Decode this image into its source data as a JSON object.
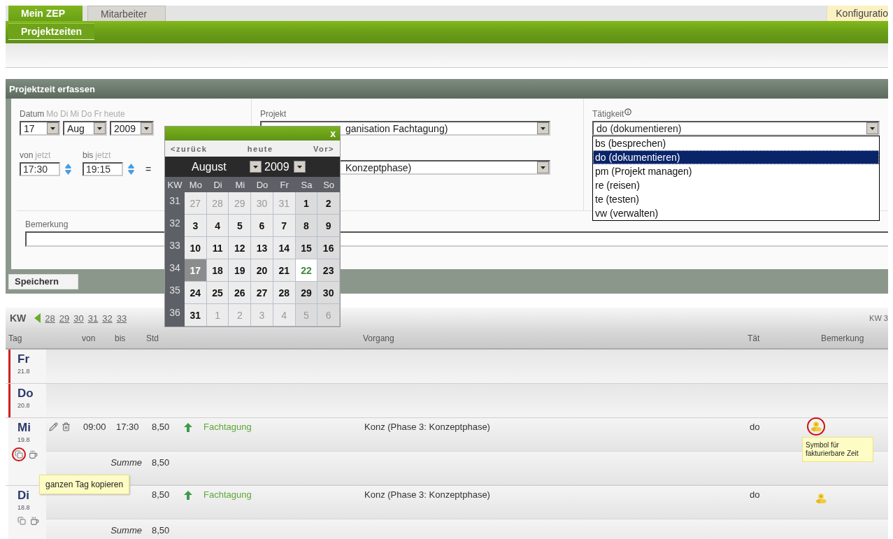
{
  "top_tabs": [
    {
      "label": "Mein ZEP",
      "selected": true
    },
    {
      "label": "Mitarbeiter",
      "selected": false
    }
  ],
  "config_tab": {
    "label": "Konfiguratio"
  },
  "sub_tabs": [
    {
      "label": "Projektzeiten",
      "selected": true
    }
  ],
  "section": {
    "title": "Projektzeit erfassen"
  },
  "form": {
    "datum": {
      "label": "Datum",
      "shortcuts": [
        "Mo",
        "Di",
        "Mi",
        "Do",
        "Fr",
        "heute"
      ],
      "day": "17",
      "month": "Aug",
      "year": "2009"
    },
    "von": {
      "label": "von",
      "link": "jetzt",
      "value": "17:30"
    },
    "bis": {
      "label": "bis",
      "link": "jetzt",
      "value": "19:15"
    },
    "equals": "=",
    "projekt": {
      "label": "Projekt",
      "value": "ganisation Fachtagung)"
    },
    "vorgang": {
      "value": "Konzeptphase)"
    },
    "taetigkeit": {
      "label": "Tätigkeit",
      "value": "do (dokumentieren)",
      "expanded": true,
      "options": [
        {
          "label": "bs (besprechen)",
          "selected": false
        },
        {
          "label": "do (dokumentieren)",
          "selected": true
        },
        {
          "label": "pm (Projekt managen)",
          "selected": false
        },
        {
          "label": "re (reisen)",
          "selected": false
        },
        {
          "label": "te (testen)",
          "selected": false
        },
        {
          "label": "vw (verwalten)",
          "selected": false
        }
      ]
    },
    "bemerkung": {
      "label": "Bemerkung"
    },
    "save_button": "Speichern"
  },
  "calendar": {
    "close": "x",
    "nav": [
      "<zurück",
      "heute",
      "Vor>"
    ],
    "month": "August",
    "year": "2009",
    "week_header": "KW",
    "weekdays": [
      "Mo",
      "Di",
      "Mi",
      "Do",
      "Fr",
      "Sa",
      "So"
    ],
    "weeks": [
      {
        "kw": "31",
        "days": [
          {
            "d": "27",
            "in_month": false,
            "selected": false,
            "today": false
          },
          {
            "d": "28",
            "in_month": false,
            "selected": false,
            "today": false
          },
          {
            "d": "29",
            "in_month": false,
            "selected": false,
            "today": false
          },
          {
            "d": "30",
            "in_month": false,
            "selected": false,
            "today": false
          },
          {
            "d": "31",
            "in_month": false,
            "selected": false,
            "today": false
          },
          {
            "d": "1",
            "in_month": true,
            "selected": false,
            "today": false
          },
          {
            "d": "2",
            "in_month": true,
            "selected": false,
            "today": false
          }
        ]
      },
      {
        "kw": "32",
        "days": [
          {
            "d": "3",
            "in_month": true,
            "selected": false,
            "today": false
          },
          {
            "d": "4",
            "in_month": true,
            "selected": false,
            "today": false
          },
          {
            "d": "5",
            "in_month": true,
            "selected": false,
            "today": false
          },
          {
            "d": "6",
            "in_month": true,
            "selected": false,
            "today": false
          },
          {
            "d": "7",
            "in_month": true,
            "selected": false,
            "today": false
          },
          {
            "d": "8",
            "in_month": true,
            "selected": false,
            "today": false
          },
          {
            "d": "9",
            "in_month": true,
            "selected": false,
            "today": false
          }
        ]
      },
      {
        "kw": "33",
        "days": [
          {
            "d": "10",
            "in_month": true,
            "selected": false,
            "today": false
          },
          {
            "d": "11",
            "in_month": true,
            "selected": false,
            "today": false
          },
          {
            "d": "12",
            "in_month": true,
            "selected": false,
            "today": false
          },
          {
            "d": "13",
            "in_month": true,
            "selected": false,
            "today": false
          },
          {
            "d": "14",
            "in_month": true,
            "selected": false,
            "today": false
          },
          {
            "d": "15",
            "in_month": true,
            "selected": false,
            "today": false
          },
          {
            "d": "16",
            "in_month": true,
            "selected": false,
            "today": false
          }
        ]
      },
      {
        "kw": "34",
        "days": [
          {
            "d": "17",
            "in_month": true,
            "selected": true,
            "today": false
          },
          {
            "d": "18",
            "in_month": true,
            "selected": false,
            "today": false
          },
          {
            "d": "19",
            "in_month": true,
            "selected": false,
            "today": false
          },
          {
            "d": "20",
            "in_month": true,
            "selected": false,
            "today": false
          },
          {
            "d": "21",
            "in_month": true,
            "selected": false,
            "today": false
          },
          {
            "d": "22",
            "in_month": true,
            "selected": false,
            "today": true
          },
          {
            "d": "23",
            "in_month": true,
            "selected": false,
            "today": false
          }
        ]
      },
      {
        "kw": "35",
        "days": [
          {
            "d": "24",
            "in_month": true,
            "selected": false,
            "today": false
          },
          {
            "d": "25",
            "in_month": true,
            "selected": false,
            "today": false
          },
          {
            "d": "26",
            "in_month": true,
            "selected": false,
            "today": false
          },
          {
            "d": "27",
            "in_month": true,
            "selected": false,
            "today": false
          },
          {
            "d": "28",
            "in_month": true,
            "selected": false,
            "today": false
          },
          {
            "d": "29",
            "in_month": true,
            "selected": false,
            "today": false
          },
          {
            "d": "30",
            "in_month": true,
            "selected": false,
            "today": false
          }
        ]
      },
      {
        "kw": "36",
        "days": [
          {
            "d": "31",
            "in_month": true,
            "selected": false,
            "today": false
          },
          {
            "d": "1",
            "in_month": false,
            "selected": false,
            "today": false
          },
          {
            "d": "2",
            "in_month": false,
            "selected": false,
            "today": false
          },
          {
            "d": "3",
            "in_month": false,
            "selected": false,
            "today": false
          },
          {
            "d": "4",
            "in_month": false,
            "selected": false,
            "today": false
          },
          {
            "d": "5",
            "in_month": false,
            "selected": false,
            "today": false
          },
          {
            "d": "6",
            "in_month": false,
            "selected": false,
            "today": false
          }
        ]
      }
    ]
  },
  "week_bar": {
    "label": "KW",
    "weeks": [
      "28",
      "29",
      "30",
      "31",
      "32",
      "33"
    ],
    "current": "KW 3"
  },
  "table": {
    "columns": [
      "Tag",
      "von",
      "bis",
      "Std",
      "Vorgang",
      "Tät",
      "Bemerkung"
    ],
    "days": [
      {
        "name": "Fr",
        "date": "21.8",
        "missing": true
      },
      {
        "name": "Do",
        "date": "20.8",
        "missing": true
      },
      {
        "name": "Mi",
        "date": "19.8",
        "missing": false,
        "copy_highlighted": true,
        "entries": [
          {
            "editable": true,
            "von": "09:00",
            "bis": "17:30",
            "std": "8,50",
            "projekt": "Fachtagung",
            "vorgang": "Konz (Phase 3: Konzeptphase)",
            "taetigkeit": "do",
            "billable": true,
            "billable_highlighted": true
          }
        ],
        "sum": {
          "label": "Summe",
          "value": "8,50"
        }
      },
      {
        "name": "Di",
        "date": "18.8",
        "missing": false,
        "copy_highlighted": false,
        "entries": [
          {
            "editable": false,
            "std": "8,50",
            "projekt": "Fachtagung",
            "vorgang": "Konz (Phase 3: Konzeptphase)",
            "taetigkeit": "do",
            "billable": true,
            "billable_highlighted": false
          }
        ],
        "sum": {
          "label": "Summe",
          "value": "8,50"
        }
      }
    ]
  },
  "tooltips": [
    {
      "kind": "copy",
      "text": "ganzen Tag kopieren"
    },
    {
      "kind": "billable",
      "text": "Symbol für fakturierbare Zeit"
    }
  ]
}
